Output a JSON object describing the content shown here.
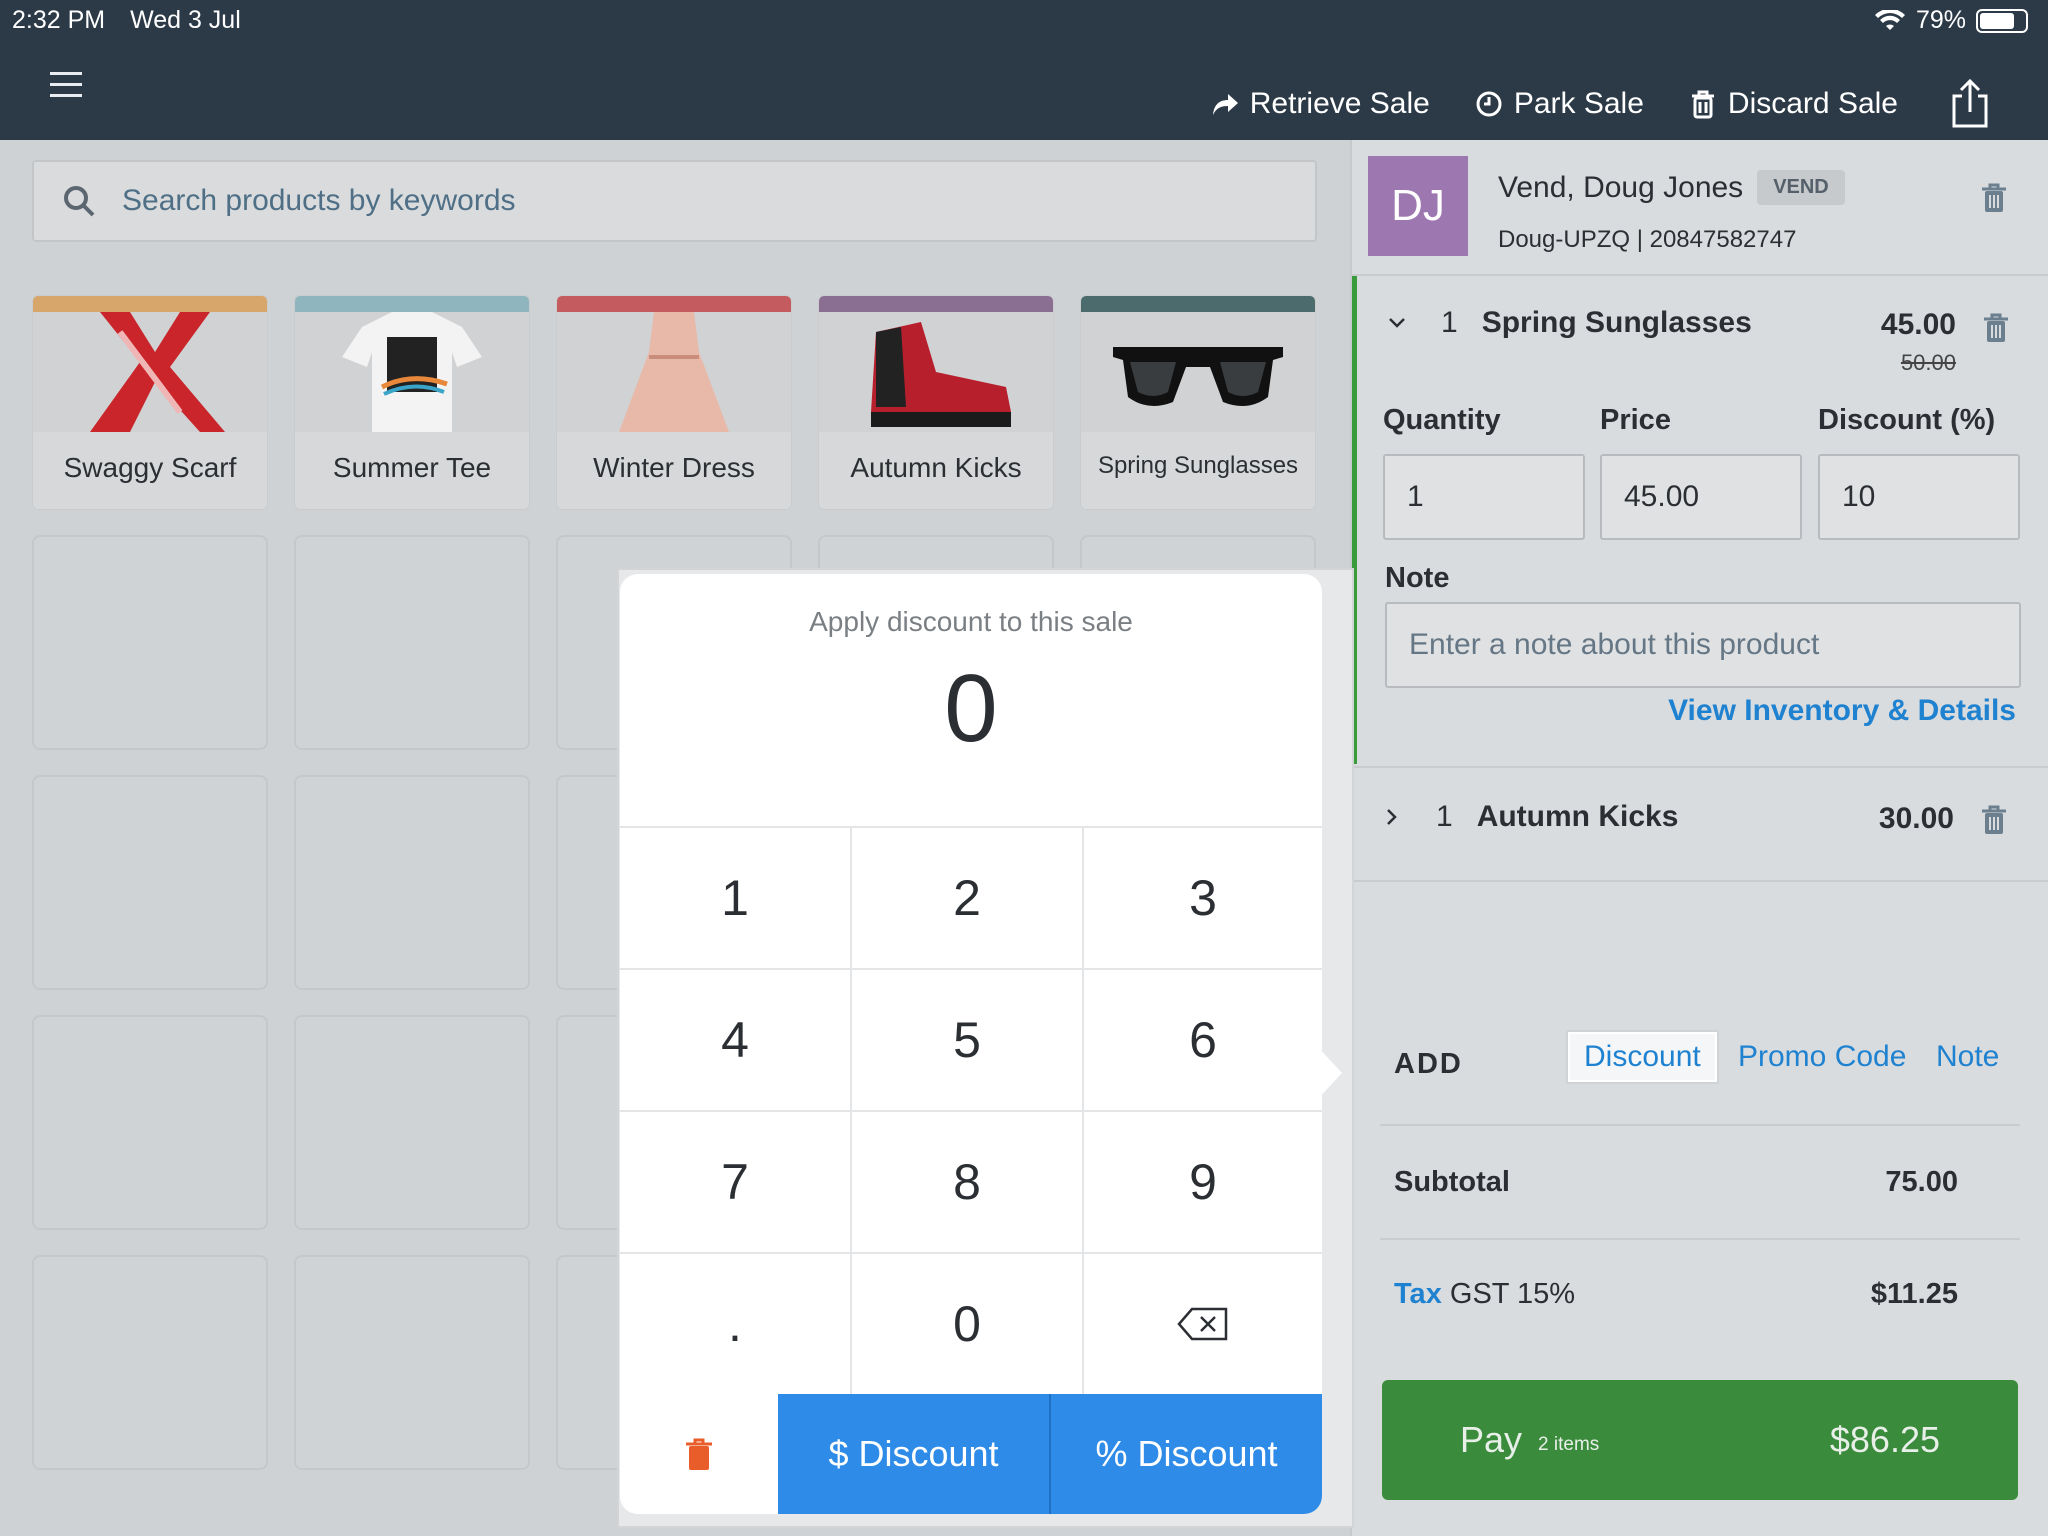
{
  "status_bar": {
    "time": "2:32 PM",
    "date": "Wed 3 Jul",
    "battery": "79%",
    "battery_level": 0.79
  },
  "header": {
    "actions": [
      {
        "label": "Retrieve Sale",
        "icon": "share-arrow-icon"
      },
      {
        "label": "Park Sale",
        "icon": "clock-icon"
      },
      {
        "label": "Discard Sale",
        "icon": "trash-icon"
      }
    ]
  },
  "search": {
    "placeholder": "Search products by keywords"
  },
  "products": [
    {
      "name": "Swaggy Scarf",
      "color": "#d7a66a"
    },
    {
      "name": "Summer Tee",
      "color": "#8fb5bf"
    },
    {
      "name": "Winter Dress",
      "color": "#c35b5f"
    },
    {
      "name": "Autumn Kicks",
      "color": "#8b6f93"
    },
    {
      "name": "Spring Sunglasses",
      "color": "#4b6b6c"
    }
  ],
  "keypad": {
    "title": "Apply discount to this sale",
    "value": "0",
    "keys": [
      "1",
      "2",
      "3",
      "4",
      "5",
      "6",
      "7",
      "8",
      "9",
      ".",
      "0"
    ],
    "dollar_discount": "$ Discount",
    "percent_discount": "% Discount"
  },
  "customer": {
    "initials": "DJ",
    "name": "Vend, Doug Jones",
    "badge": "VEND",
    "code": "Doug-UPZQ | 20847582747"
  },
  "line_items": [
    {
      "qty": "1",
      "name": "Spring Sunglasses",
      "price": "45.00",
      "original_price": "50.00",
      "quantity_label": "Quantity",
      "price_label": "Price",
      "discount_label": "Discount (%)",
      "quantity": "1",
      "unit_price": "45.00",
      "discount": "10",
      "note_label": "Note",
      "note_placeholder": "Enter a note about this product",
      "details_link": "View Inventory & Details"
    },
    {
      "qty": "1",
      "name": "Autumn Kicks",
      "price": "30.00"
    }
  ],
  "add": {
    "label": "ADD",
    "discount": "Discount",
    "promo": "Promo Code",
    "note": "Note"
  },
  "totals": {
    "subtotal_label": "Subtotal",
    "subtotal": "75.00",
    "tax_link": "Tax",
    "tax_label": "GST 15%",
    "tax": "$11.25"
  },
  "pay": {
    "label": "Pay",
    "items": "2 items",
    "amount": "$86.25"
  },
  "colors": {
    "header": "#2c3a47",
    "accent_blue": "#2e8be8",
    "pay_green": "#3a8c3c",
    "danger": "#e85d2a"
  }
}
